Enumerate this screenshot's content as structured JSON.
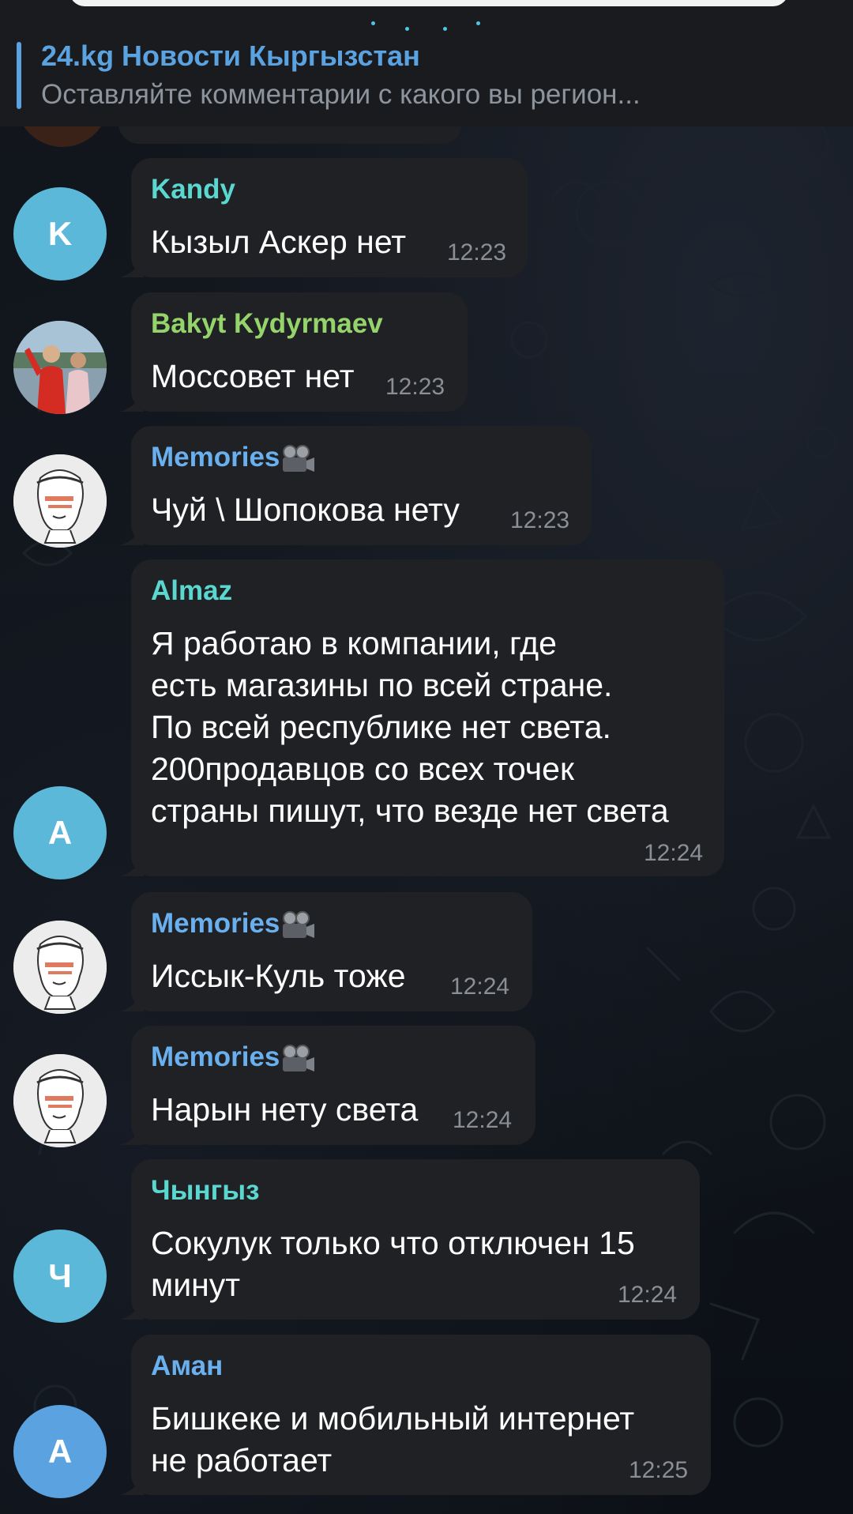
{
  "pinned": {
    "title": "24.kg Новости Кыргызстан",
    "subtitle": "Оставляйте комментарии с какого вы регион..."
  },
  "colors": {
    "background": "#0e1218",
    "bubble": "#202125",
    "pinned_accent": "#5aa2e0",
    "text": "#ffffff",
    "time": "#8a8e95"
  },
  "messages": [
    {
      "sender": "Kandy",
      "sender_color": "#5ad8d0",
      "text": "Кызыл Аскер нет",
      "time": "12:23",
      "avatar": {
        "type": "letter",
        "letter": "K",
        "color": "#5bb8d8"
      }
    },
    {
      "sender": "Bakyt Kydyrmaev",
      "sender_color": "#94d46a",
      "text": "Моссовет нет",
      "time": "12:23",
      "avatar": {
        "type": "photo",
        "icon": "profile-photo-icon"
      }
    },
    {
      "sender": "Memories",
      "sender_color": "#6ab0ee",
      "sender_emoji": "film-projector-icon",
      "text": "Чуй \\ Шопокова нету",
      "time": "12:23",
      "avatar": {
        "type": "drawing",
        "icon": "statue-sketch-icon"
      }
    },
    {
      "sender": "Almaz",
      "sender_color": "#5ad8d0",
      "text": "Я работаю в компании, где\nесть магазины по всей стране.\nПо всей республике нет света.\n200продавцов со всех точек\nстраны пишут, что везде нет света",
      "time": "12:24",
      "avatar": {
        "type": "letter",
        "letter": "A",
        "color": "#5bb8d8"
      }
    },
    {
      "sender": "Memories",
      "sender_color": "#6ab0ee",
      "sender_emoji": "film-projector-icon",
      "text": "Иссык-Куль тоже",
      "time": "12:24",
      "avatar": {
        "type": "drawing",
        "icon": "statue-sketch-icon"
      }
    },
    {
      "sender": "Memories",
      "sender_color": "#6ab0ee",
      "sender_emoji": "film-projector-icon",
      "text": "Нарын нету света",
      "time": "12:24",
      "avatar": {
        "type": "drawing",
        "icon": "statue-sketch-icon"
      }
    },
    {
      "sender": "Чынгыз",
      "sender_color": "#5ad8d0",
      "text": "Сокулук только что отключен 15\nминут",
      "time": "12:24",
      "avatar": {
        "type": "letter",
        "letter": "Ч",
        "color": "#5bb8d8"
      }
    },
    {
      "sender": "Аман",
      "sender_color": "#6ab0ee",
      "text": "Бишкеке и мобильный интернет\nне работает",
      "time": "12:25",
      "avatar": {
        "type": "letter",
        "letter": "А",
        "color": "#5aa2e0"
      }
    }
  ]
}
